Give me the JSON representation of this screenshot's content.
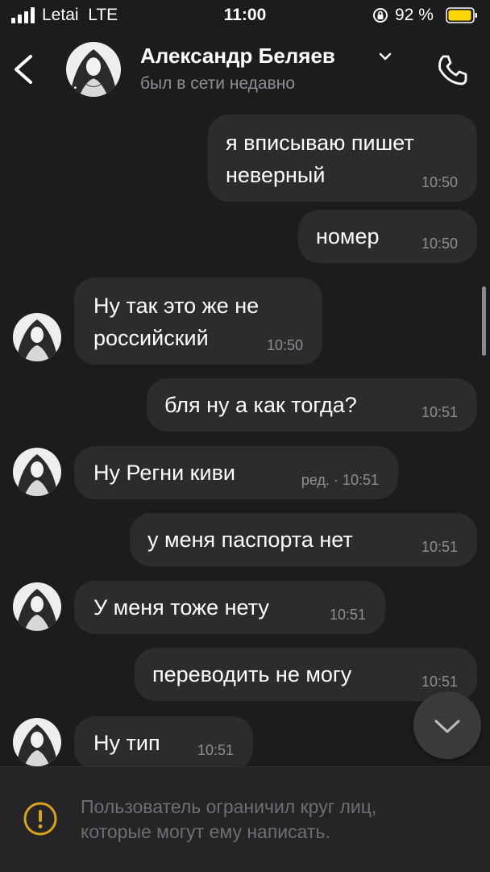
{
  "status_bar": {
    "carrier": "Letai",
    "network": "LTE",
    "time": "11:00",
    "battery_pct": "92 %",
    "battery_color": "#ffd60a"
  },
  "header": {
    "name": "Александр Беляев",
    "status": "был в сети недавно",
    "icons": {
      "back": "chevron-left-icon",
      "expand": "chevron-down-icon",
      "call": "phone-icon"
    }
  },
  "messages": [
    {
      "side": "out",
      "lines": [
        "я вписываю пишет",
        "неверный"
      ],
      "time": "10:50"
    },
    {
      "side": "out",
      "lines": [
        "номер"
      ],
      "time": "10:50"
    },
    {
      "side": "in",
      "lines": [
        "Ну так это же не",
        "российский"
      ],
      "time": "10:50"
    },
    {
      "side": "out",
      "lines": [
        "бля ну а как тогда?"
      ],
      "time": "10:51"
    },
    {
      "side": "in",
      "lines": [
        "Ну Регни киви"
      ],
      "time": "ред. · 10:51"
    },
    {
      "side": "out",
      "lines": [
        "у меня паспорта нет"
      ],
      "time": "10:51"
    },
    {
      "side": "in",
      "lines": [
        "У меня тоже нету"
      ],
      "time": "10:51"
    },
    {
      "side": "out",
      "lines": [
        "переводить не могу"
      ],
      "time": "10:51"
    },
    {
      "side": "in",
      "lines": [
        "Ну тип"
      ],
      "time": "10:51"
    }
  ],
  "notice": {
    "line1": "Пользователь ограничил круг лиц,",
    "line2": "которые могут ему написать.",
    "icon": "warning-icon",
    "icon_color": "#d9a21b"
  },
  "colors": {
    "background": "#1c1c1e",
    "bubble": "#2c2c2e",
    "secondary_text": "#8e8e93"
  }
}
